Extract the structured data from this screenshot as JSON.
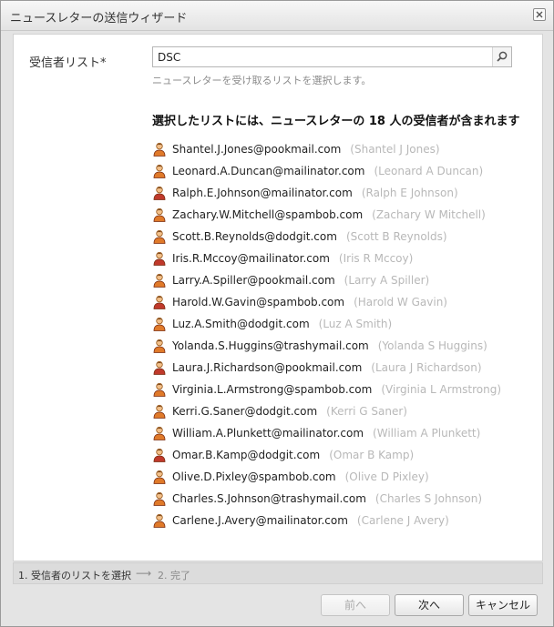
{
  "dialog": {
    "title": "ニュースレターの送信ウィザード"
  },
  "form": {
    "label": "受信者リスト*",
    "search_value": "DSC",
    "hint": "ニュースレターを受け取るリストを選択します。",
    "summary": "選択したリストには、ニュースレターの 18 人の受信者が含まれます"
  },
  "recipients": [
    {
      "email": "Shantel.J.Jones@pookmail.com",
      "name": "(Shantel J Jones)",
      "icon_color": "#e07a2a"
    },
    {
      "email": "Leonard.A.Duncan@mailinator.com",
      "name": "(Leonard A Duncan)",
      "icon_color": "#e07a2a"
    },
    {
      "email": "Ralph.E.Johnson@mailinator.com",
      "name": "(Ralph E Johnson)",
      "icon_color": "#c0392b"
    },
    {
      "email": "Zachary.W.Mitchell@spambob.com",
      "name": "(Zachary W Mitchell)",
      "icon_color": "#e07a2a"
    },
    {
      "email": "Scott.B.Reynolds@dodgit.com",
      "name": "(Scott B Reynolds)",
      "icon_color": "#e07a2a"
    },
    {
      "email": "Iris.R.Mccoy@mailinator.com",
      "name": "(Iris R Mccoy)",
      "icon_color": "#c0392b"
    },
    {
      "email": "Larry.A.Spiller@pookmail.com",
      "name": "(Larry A Spiller)",
      "icon_color": "#e07a2a"
    },
    {
      "email": "Harold.W.Gavin@spambob.com",
      "name": "(Harold W Gavin)",
      "icon_color": "#c0392b"
    },
    {
      "email": "Luz.A.Smith@dodgit.com",
      "name": "(Luz A Smith)",
      "icon_color": "#e07a2a"
    },
    {
      "email": "Yolanda.S.Huggins@trashymail.com",
      "name": "(Yolanda S Huggins)",
      "icon_color": "#e07a2a"
    },
    {
      "email": "Laura.J.Richardson@pookmail.com",
      "name": "(Laura J Richardson)",
      "icon_color": "#c0392b"
    },
    {
      "email": "Virginia.L.Armstrong@spambob.com",
      "name": "(Virginia L Armstrong)",
      "icon_color": "#e07a2a"
    },
    {
      "email": "Kerri.G.Saner@dodgit.com",
      "name": "(Kerri G Saner)",
      "icon_color": "#e07a2a"
    },
    {
      "email": "William.A.Plunkett@mailinator.com",
      "name": "(William A Plunkett)",
      "icon_color": "#e07a2a"
    },
    {
      "email": "Omar.B.Kamp@dodgit.com",
      "name": "(Omar B Kamp)",
      "icon_color": "#c0392b"
    },
    {
      "email": "Olive.D.Pixley@spambob.com",
      "name": "(Olive D Pixley)",
      "icon_color": "#e07a2a"
    },
    {
      "email": "Charles.S.Johnson@trashymail.com",
      "name": "(Charles S Johnson)",
      "icon_color": "#e07a2a"
    },
    {
      "email": "Carlene.J.Avery@mailinator.com",
      "name": "(Carlene J Avery)",
      "icon_color": "#e07a2a"
    }
  ],
  "steps": {
    "current": "1. 受信者のリストを選択",
    "arrow": "⟶",
    "next": "2. 完了"
  },
  "buttons": {
    "prev": "前へ",
    "next": "次へ",
    "cancel": "キャンセル"
  }
}
